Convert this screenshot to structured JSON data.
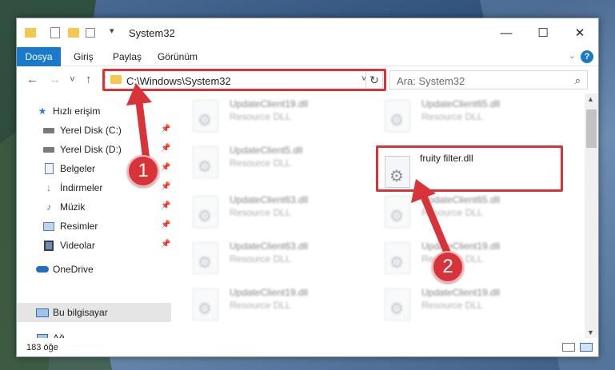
{
  "window": {
    "title": "System32",
    "controls": {
      "minimize": "—",
      "maximize": "☐",
      "close": "✕"
    }
  },
  "ribbon": {
    "tabs": [
      "Dosya",
      "Giriş",
      "Paylaş",
      "Görünüm"
    ],
    "help": "?"
  },
  "nav": {
    "back": "←",
    "forward": "→",
    "recent": "˅",
    "up": "↑",
    "address": "C:\\Windows\\System32",
    "address_dropdown": "˅",
    "refresh": "↻",
    "search_placeholder": "Ara: System32"
  },
  "sidebar": {
    "quick_access": "Hızlı erişim",
    "items": [
      {
        "label": "Yerel Disk (C:)",
        "icon": "drive-icon",
        "pinned": true
      },
      {
        "label": "Yerel Disk (D:)",
        "icon": "drive-icon",
        "pinned": true
      },
      {
        "label": "Belgeler",
        "icon": "documents-icon",
        "pinned": true
      },
      {
        "label": "İndirmeler",
        "icon": "downloads-icon",
        "pinned": true
      },
      {
        "label": "Müzik",
        "icon": "music-icon",
        "pinned": true
      },
      {
        "label": "Resimler",
        "icon": "pictures-icon",
        "pinned": true
      },
      {
        "label": "Videolar",
        "icon": "videos-icon",
        "pinned": true
      }
    ],
    "onedrive": "OneDrive",
    "this_pc": "Bu bilgisayar",
    "network": "Ağ"
  },
  "files": [
    {
      "name": "UpdateClient19.dll",
      "desc": "Resource DLL"
    },
    {
      "name": "UpdateClient65.dll",
      "desc": "Resource DLL"
    },
    {
      "name": "UpdateClient5.dll",
      "desc": "Resource DLL"
    },
    {
      "name": "fruity filter.dll",
      "desc": ""
    },
    {
      "name": "UpdateClient63.dll",
      "desc": "Resource DLL"
    },
    {
      "name": "UpdateClient65.dll",
      "desc": "Resource DLL"
    },
    {
      "name": "UpdateClient63.dll",
      "desc": "Resource DLL"
    },
    {
      "name": "UpdateClient19.dll",
      "desc": "Resource DLL"
    },
    {
      "name": "UpdateClient19.dll",
      "desc": "Resource DLL"
    },
    {
      "name": "UpdateClient19.dll",
      "desc": "Resource DLL"
    }
  ],
  "status": {
    "count": "183 öğe"
  },
  "callouts": [
    "1",
    "2"
  ],
  "colors": {
    "accent": "#1979ca",
    "highlight": "#d9333a"
  }
}
